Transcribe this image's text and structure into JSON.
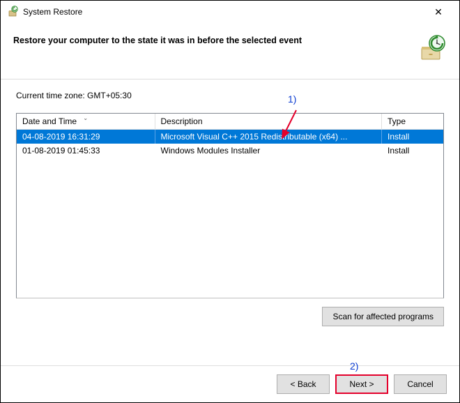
{
  "window": {
    "title": "System Restore"
  },
  "header": {
    "text": "Restore your computer to the state it was in before the selected event"
  },
  "timezone": {
    "label": "Current time zone: GMT+05:30"
  },
  "table": {
    "columns": {
      "date": "Date and Time",
      "description": "Description",
      "type": "Type"
    },
    "rows": [
      {
        "date": "04-08-2019 16:31:29",
        "description": "Microsoft Visual C++ 2015 Redistributable (x64) ...",
        "type": "Install",
        "selected": true
      },
      {
        "date": "01-08-2019 01:45:33",
        "description": "Windows Modules Installer",
        "type": "Install",
        "selected": false
      }
    ]
  },
  "buttons": {
    "scan": "Scan for affected programs",
    "back": "< Back",
    "next": "Next >",
    "cancel": "Cancel"
  },
  "annotations": {
    "one": "1)",
    "two": "2)"
  }
}
